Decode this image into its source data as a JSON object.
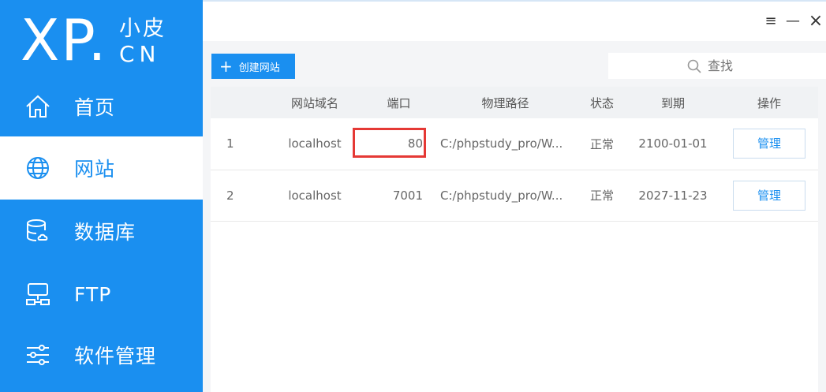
{
  "brand": {
    "logo_main": "XP.",
    "logo_small": "小皮",
    "logo_domain": "CN"
  },
  "sidebar": {
    "items": [
      {
        "label": "首页",
        "icon": "home-icon",
        "active": false
      },
      {
        "label": "网站",
        "icon": "globe-icon",
        "active": true
      },
      {
        "label": "数据库",
        "icon": "database-icon",
        "active": false
      },
      {
        "label": "FTP",
        "icon": "ftp-icon",
        "active": false
      },
      {
        "label": "软件管理",
        "icon": "sliders-icon",
        "active": false
      }
    ]
  },
  "window": {
    "menu_glyph": "≡",
    "minimize_glyph": "—",
    "close_glyph": "×"
  },
  "toolbar": {
    "create_label": "创建网站",
    "search_placeholder": "查找"
  },
  "table": {
    "headers": [
      "",
      "网站域名",
      "端口",
      "物理路径",
      "状态",
      "到期",
      "操作"
    ],
    "rows": [
      {
        "num": "1",
        "domain": "localhost",
        "port": "80",
        "path": "C:/phpstudy_pro/W...",
        "status": "正常",
        "expire": "2100-01-01",
        "action": "管理"
      },
      {
        "num": "2",
        "domain": "localhost",
        "port": "7001",
        "path": "C:/phpstudy_pro/W...",
        "status": "正常",
        "expire": "2027-11-23",
        "action": "管理"
      }
    ]
  },
  "colors": {
    "accent": "#1a8ff0",
    "highlight": "#e53935"
  }
}
